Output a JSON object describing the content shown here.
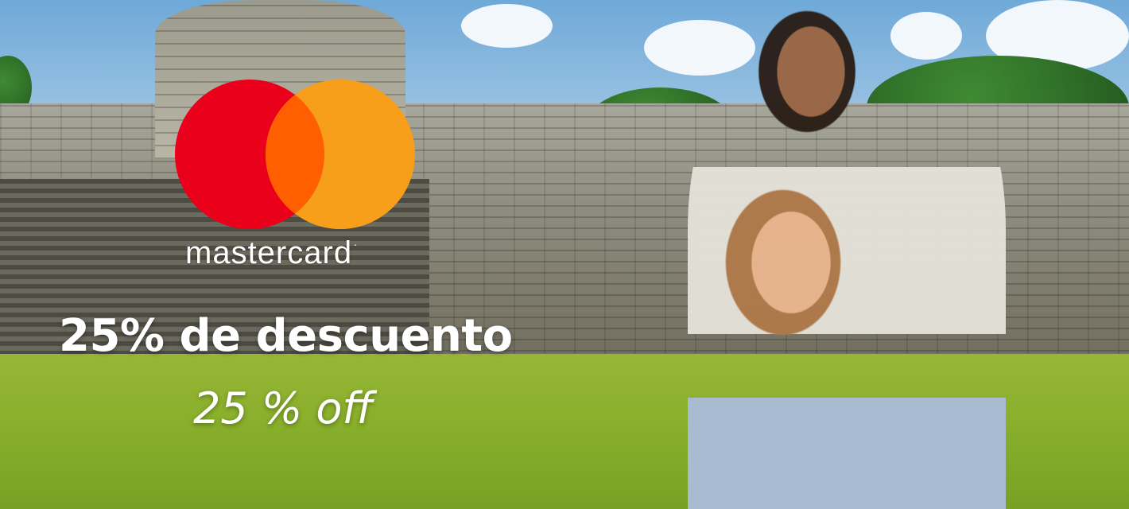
{
  "brand": {
    "name": "mastercard",
    "colors": {
      "red": "#eb001b",
      "yellow": "#f79e1b",
      "overlap": "#ff5f00"
    }
  },
  "promo": {
    "headline": "25% de descuento",
    "subline": "25 % off"
  }
}
